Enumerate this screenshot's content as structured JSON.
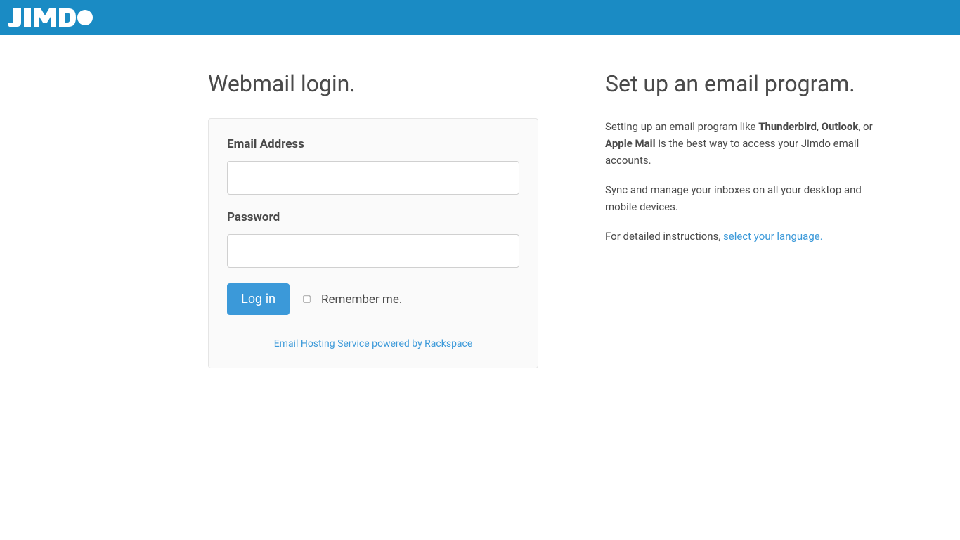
{
  "header": {
    "logo_text": "JIMDO"
  },
  "login": {
    "title": "Webmail login.",
    "email_label": "Email Address",
    "password_label": "Password",
    "button_label": "Log in",
    "remember_label": "Remember me.",
    "footer_link_text": "Email Hosting Service powered by Rackspace"
  },
  "setup": {
    "title": "Set up an email program.",
    "para1_prefix": "Setting up an email program like ",
    "para1_app1": "Thunderbird",
    "para1_sep1": ", ",
    "para1_app2": "Outlook",
    "para1_sep2": ", or ",
    "para1_app3": "Apple Mail",
    "para1_suffix": " is the best way to access your Jimdo email accounts.",
    "para2": "Sync and manage your inboxes on all your desktop and mobile devices.",
    "para3_prefix": "For detailed instructions, ",
    "para3_link": "select your language."
  }
}
